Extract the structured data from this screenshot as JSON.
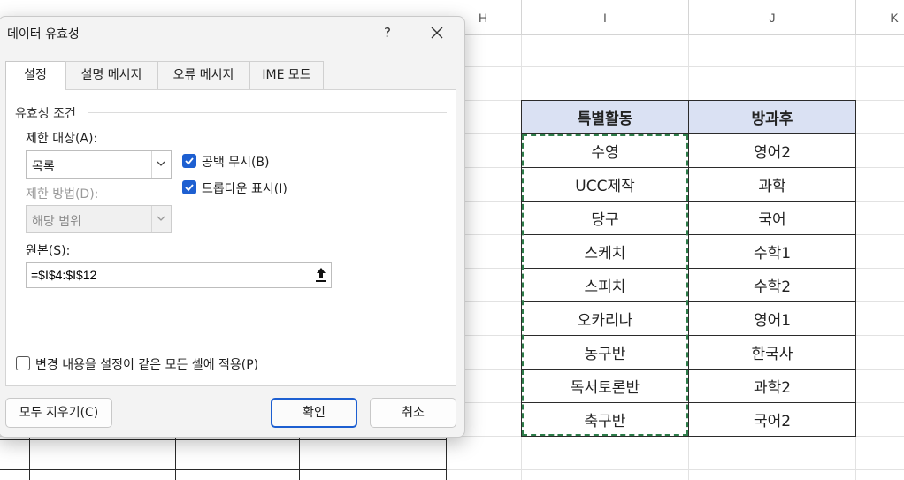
{
  "sheet": {
    "columns": [
      "H",
      "I",
      "J",
      "K"
    ],
    "table": {
      "headers": [
        "특별활동",
        "방과후"
      ],
      "rows": [
        [
          "수영",
          "영어2"
        ],
        [
          "UCC제작",
          "과학"
        ],
        [
          "당구",
          "국어"
        ],
        [
          "스케치",
          "수학1"
        ],
        [
          "스피치",
          "수학2"
        ],
        [
          "오카리나",
          "영어1"
        ],
        [
          "농구반",
          "한국사"
        ],
        [
          "독서토론반",
          "과학2"
        ],
        [
          "축구반",
          "국어2"
        ]
      ]
    }
  },
  "dialog": {
    "title": "데이터 유효성",
    "help": "?",
    "close": "✕",
    "tabs": [
      "설정",
      "설명 메시지",
      "오류 메시지",
      "IME 모드"
    ],
    "active_tab": 0,
    "group_title": "유효성 조건",
    "allow_label": "제한 대상(A):",
    "allow_value": "목록",
    "ignore_blank_label": "공백 무시(B)",
    "ignore_blank_checked": true,
    "dropdown_label": "드롭다운 표시(I)",
    "dropdown_checked": true,
    "data_label": "제한 방법(D):",
    "data_value": "해당 범위",
    "source_label": "원본(S):",
    "source_value": "=$I$4:$I$12",
    "apply_all_label": "변경 내용을 설정이 같은 모든 셀에 적용(P)",
    "apply_all_checked": false,
    "clear_all": "모두 지우기(C)",
    "ok": "확인",
    "cancel": "취소"
  },
  "colors": {
    "header_fill": "#dae1f3",
    "accent": "#1d5fd1",
    "marquee": "#2e7d4a"
  }
}
